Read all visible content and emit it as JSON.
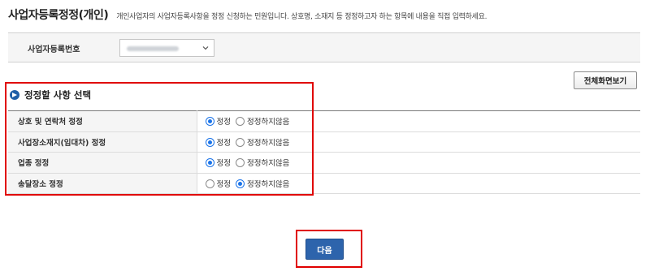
{
  "header": {
    "title": "사업자등록정정(개인)",
    "description": "개인사업자의 사업자등록사항을 정정 신청하는 민원입니다. 상호명, 소재지 등 정정하고자 하는 항목에 내용을 직접 입력하세요."
  },
  "business_number": {
    "label": "사업자등록번호",
    "value": ""
  },
  "toolbar": {
    "fullscreen_label": "전체화면보기"
  },
  "section": {
    "title": "정정할 사항 선택"
  },
  "options": {
    "yes_label": "정정",
    "no_label": "정정하지않음",
    "rows": [
      {
        "label": "상호 및 연락처 정정",
        "selected": "정정"
      },
      {
        "label": "사업장소재지(임대차) 정정",
        "selected": "정정"
      },
      {
        "label": "업종 정정",
        "selected": "정정"
      },
      {
        "label": "송달장소 정정",
        "selected": "정정하지않음"
      }
    ]
  },
  "footer": {
    "next_label": "다음"
  },
  "colors": {
    "accent": "#2d64ac",
    "highlight": "#e00000",
    "radio_selected": "#1a73e8"
  }
}
